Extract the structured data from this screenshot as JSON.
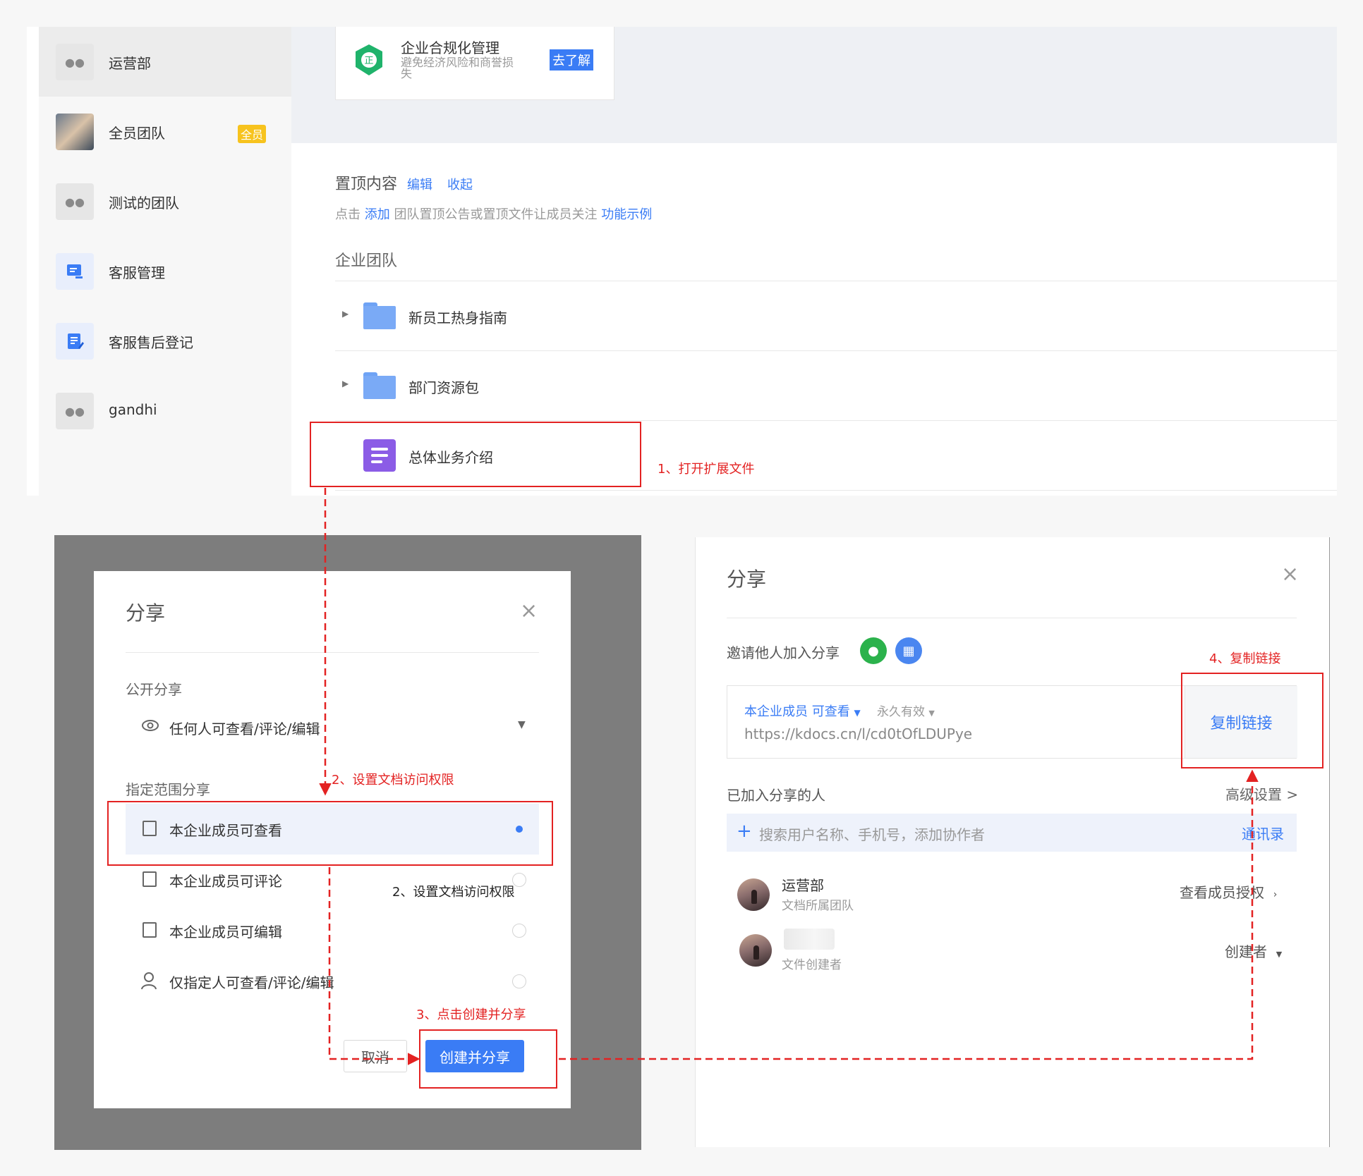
{
  "sidebar": {
    "items": [
      {
        "label": "运营部",
        "icon": "team-icon"
      },
      {
        "label": "全员团队",
        "badge": "全员",
        "icon": "team-photo-avatar"
      },
      {
        "label": "测试的团队",
        "icon": "team-icon"
      },
      {
        "label": "客服管理",
        "icon": "chat-board-icon"
      },
      {
        "label": "客服售后登记",
        "icon": "form-edit-icon"
      },
      {
        "label": "gandhi",
        "icon": "team-icon"
      }
    ]
  },
  "compliance": {
    "title": "企业合规化管理",
    "subtitle": "避免经济风险和商誉损失",
    "button": "去了解",
    "icon_text": "正"
  },
  "pinned": {
    "title": "置顶内容",
    "edit": "编辑",
    "collapse": "收起",
    "desc_prefix": "点击",
    "desc_add": "添加",
    "desc_middle": "团队置顶公告或置顶文件让成员关注",
    "desc_example": "功能示例"
  },
  "team_section": {
    "title": "企业团队",
    "files": [
      {
        "name": "新员工热身指南",
        "type": "folder"
      },
      {
        "name": "部门资源包",
        "type": "folder"
      },
      {
        "name": "总体业务介绍",
        "type": "document"
      }
    ]
  },
  "annotations": {
    "step1": "1、打开扩展文件",
    "step2": "2、设置文档访问权限",
    "step2_dup": "2、设置文档访问权限",
    "step3": "3、点击创建并分享",
    "step4": "4、复制链接"
  },
  "share_dialog": {
    "title": "分享",
    "close": "×",
    "public_label": "公开分享",
    "public_option": "任何人可查看/评论/编辑",
    "scope_label": "指定范围分享",
    "options": [
      {
        "label": "本企业成员可查看",
        "selected": true
      },
      {
        "label": "本企业成员可评论",
        "selected": false
      },
      {
        "label": "本企业成员可编辑",
        "selected": false
      },
      {
        "label": "仅指定人可查看/评论/编辑",
        "selected": false
      }
    ],
    "cancel": "取消",
    "create": "创建并分享"
  },
  "share_panel": {
    "title": "分享",
    "close": "×",
    "invite_label": "邀请他人加入分享",
    "link_permission": "本企业成员 可查看",
    "link_validity": "永久有效",
    "link_url": "https://kdocs.cn/l/cd0tOfLDUPye",
    "copy_link": "复制链接",
    "joined_label": "已加入分享的人",
    "advanced": "高级设置 >",
    "search_placeholder": "搜索用户名称、手机号，添加协作者",
    "contacts": "通讯录",
    "members": [
      {
        "name": "运营部",
        "sub": "文档所属团队",
        "right": "查看成员授权"
      },
      {
        "name": "",
        "sub": "文件创建者",
        "right": "创建者"
      }
    ]
  },
  "colors": {
    "accent": "#3a7cf5",
    "annotation": "#e32222",
    "badge": "#f7c31e",
    "wechat": "#2bb24c",
    "doc": "#8b5ce6"
  }
}
